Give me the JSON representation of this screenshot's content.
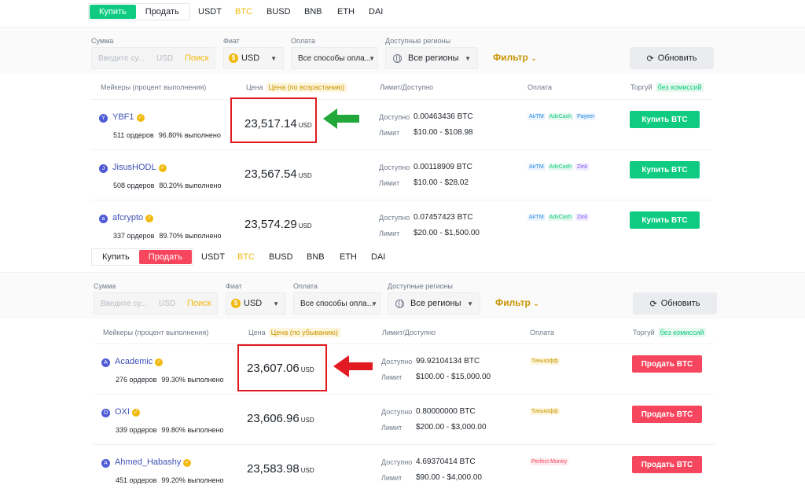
{
  "buy_panel": {
    "toggle": {
      "buy": "Купить",
      "sell": "Продать",
      "active": "buy"
    },
    "coins": [
      "USDT",
      "BTC",
      "BUSD",
      "BNB",
      "ETH",
      "DAI"
    ],
    "active_coin": "BTC",
    "filters": {
      "amount_label": "Сумма",
      "amount_placeholder": "Введите су...",
      "amount_unit": "USD",
      "search": "Поиск",
      "fiat_label": "Фиат",
      "fiat_value": "USD",
      "payment_label": "Оплата",
      "payment_value": "Все способы опла...",
      "regions_label": "Доступные регионы",
      "regions_value": "Все регионы",
      "filter_btn": "Фильтр",
      "refresh_btn": "Обновить"
    },
    "columns": {
      "makers": "Мейкеры (процент выполнения)",
      "price": "Цена",
      "price_sort": "Цена (по возрастанию)",
      "limit": "Лимит/Доступно",
      "payment": "Оплата",
      "trade": "Торгуй",
      "no_fee": "без комиссий"
    },
    "rows": [
      {
        "initial": "Y",
        "name": "YBF1",
        "orders": "511 ордеров",
        "completion": "96.80% выполнено",
        "price": "23,517.14",
        "currency": "USD",
        "available_label": "Доступно",
        "available": "0.00463436 BTC",
        "limit_label": "Лимит",
        "limit": "$10.00 - $108.98",
        "payments": [
          "AirTM",
          "AdvCash",
          "Payeer"
        ],
        "action": "Купить BTC"
      },
      {
        "initial": "J",
        "name": "JisusHODL",
        "orders": "508 ордеров",
        "completion": "80.20% выполнено",
        "price": "23,567.54",
        "currency": "USD",
        "available_label": "Доступно",
        "available": "0.00118909 BTC",
        "limit_label": "Лимит",
        "limit": "$10.00 - $28.02",
        "payments": [
          "AirTM",
          "AdvCash",
          "Zinli"
        ],
        "action": "Купить BTC"
      },
      {
        "initial": "a",
        "name": "afcrypto",
        "orders": "337 ордеров",
        "completion": "89.70% выполнено",
        "price": "23,574.29",
        "currency": "USD",
        "available_label": "Доступно",
        "available": "0.07457423 BTC",
        "limit_label": "Лимит",
        "limit": "$20.00 - $1,500.00",
        "payments": [
          "AirTM",
          "AdvCash",
          "Zinli"
        ],
        "action": "Купить BTC"
      }
    ]
  },
  "sell_panel": {
    "toggle": {
      "buy": "Купить",
      "sell": "Продать",
      "active": "sell"
    },
    "coins": [
      "USDT",
      "BTC",
      "BUSD",
      "BNB",
      "ETH",
      "DAI"
    ],
    "active_coin": "BTC",
    "filters": {
      "amount_label": "Сумма",
      "amount_placeholder": "Введите су...",
      "amount_unit": "USD",
      "search": "Поиск",
      "fiat_label": "Фиат",
      "fiat_value": "USD",
      "payment_label": "Оплата",
      "payment_value": "Все способы опла...",
      "regions_label": "Доступные регионы",
      "regions_value": "Все регионы",
      "filter_btn": "Фильтр",
      "refresh_btn": "Обновить"
    },
    "columns": {
      "makers": "Мейкеры (процент выполнения)",
      "price": "Цена",
      "price_sort": "Цена (по убыванию)",
      "limit": "Лимит/Доступно",
      "payment": "Оплата",
      "trade": "Торгуй",
      "no_fee": "без комиссий"
    },
    "rows": [
      {
        "initial": "A",
        "name": "Academic",
        "orders": "276 ордеров",
        "completion": "99.30% выполнено",
        "price": "23,607.06",
        "currency": "USD",
        "available_label": "Доступно",
        "available": "99.92104134 BTC",
        "limit_label": "Лимит",
        "limit": "$100.00 - $15,000.00",
        "payments": [
          "Тинькофф"
        ],
        "action": "Продать BTC"
      },
      {
        "initial": "O",
        "name": "OXI",
        "orders": "339 ордеров",
        "completion": "99.80% выполнено",
        "price": "23,606.96",
        "currency": "USD",
        "available_label": "Доступно",
        "available": "0.80000000 BTC",
        "limit_label": "Лимит",
        "limit": "$200.00 - $3,000.00",
        "payments": [
          "Тинькофф"
        ],
        "action": "Продать BTC"
      },
      {
        "initial": "A",
        "name": "Ahmed_Habashy",
        "orders": "451 ордеров",
        "completion": "99.20% выполнено",
        "price": "23,583.98",
        "currency": "USD",
        "available_label": "Доступно",
        "available": "4.69370414 BTC",
        "limit_label": "Лимит",
        "limit": "$90.00 - $4,000.00",
        "payments": [
          "Perfect Money"
        ],
        "action": "Продать BTC"
      }
    ]
  },
  "colors": {
    "buy": "#0ecb81",
    "sell": "#f6465d",
    "accent": "#f0b90b",
    "highlight": "#e21b23",
    "arrow_green": "#22a83a",
    "arrow_red": "#e21b23"
  }
}
